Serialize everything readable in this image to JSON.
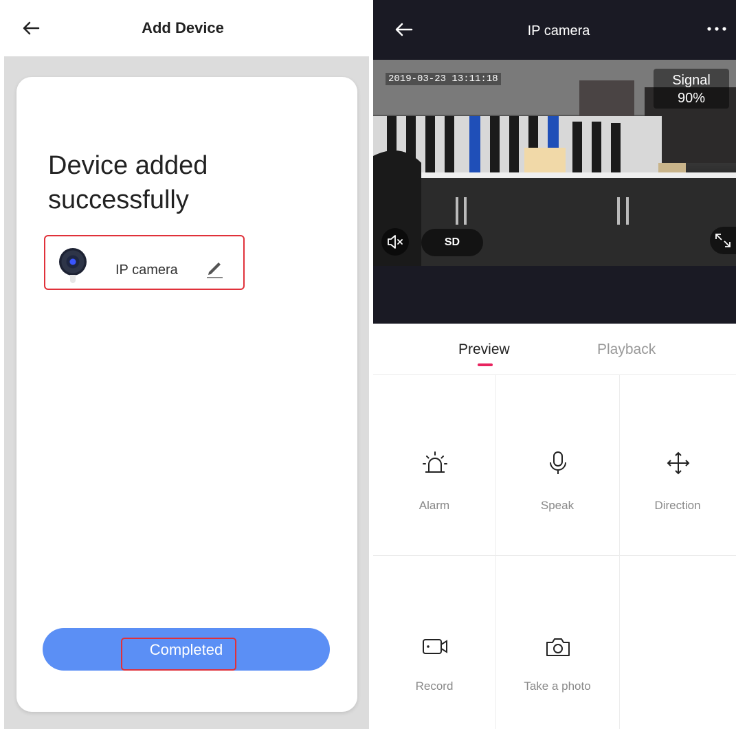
{
  "add_device": {
    "title": "Add Device",
    "heading": "Device added successfully",
    "device_name": "IP camera",
    "completed_label": "Completed"
  },
  "camera_view": {
    "title": "IP camera",
    "timestamp": "2019-03-23 13:11:18",
    "signal_label": "Signal",
    "signal_value": "90%",
    "quality_label": "SD",
    "tabs": [
      {
        "label": "Preview",
        "active": true
      },
      {
        "label": "Playback",
        "active": false
      }
    ],
    "actions": [
      {
        "label": "Alarm",
        "icon": "alarm-icon"
      },
      {
        "label": "Speak",
        "icon": "microphone-icon"
      },
      {
        "label": "Direction",
        "icon": "direction-icon"
      },
      {
        "label": "Record",
        "icon": "video-record-icon"
      },
      {
        "label": "Take a photo",
        "icon": "camera-icon"
      }
    ]
  },
  "colors": {
    "primary_button": "#5b8ff5",
    "highlight_border": "#e0313a",
    "tab_accent": "#e8245f",
    "dark_bar": "#1a1a24"
  }
}
